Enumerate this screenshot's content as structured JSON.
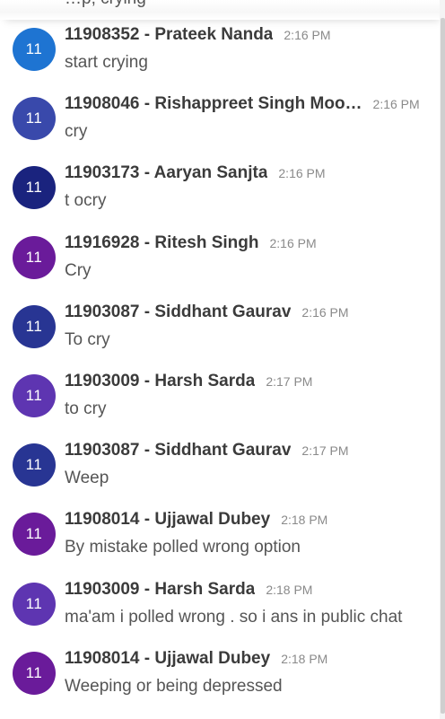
{
  "partial_top_text": "…p, crying",
  "messages": [
    {
      "avatar": "11",
      "color": "#1e74d2",
      "sender": "11908352 - Prateek Nanda",
      "time": "2:16 PM",
      "text": "start crying"
    },
    {
      "avatar": "11",
      "color": "#3949ab",
      "sender": "11908046 - Rishappreet Singh Moo…",
      "time": "2:16 PM",
      "text": "cry"
    },
    {
      "avatar": "11",
      "color": "#1a237e",
      "sender": "11903173 - Aaryan Sanjta",
      "time": "2:16 PM",
      "text": "t ocry"
    },
    {
      "avatar": "11",
      "color": "#6a1b9a",
      "sender": "11916928 - Ritesh Singh",
      "time": "2:16 PM",
      "text": "Cry"
    },
    {
      "avatar": "11",
      "color": "#283593",
      "sender": "11903087 - Siddhant Gaurav",
      "time": "2:16 PM",
      "text": "To cry"
    },
    {
      "avatar": "11",
      "color": "#5e35b1",
      "sender": "11903009 - Harsh Sarda",
      "time": "2:17 PM",
      "text": "to cry"
    },
    {
      "avatar": "11",
      "color": "#283593",
      "sender": "11903087 - Siddhant Gaurav",
      "time": "2:17 PM",
      "text": "Weep"
    },
    {
      "avatar": "11",
      "color": "#6a1b9a",
      "sender": "11908014 - Ujjawal Dubey",
      "time": "2:18 PM",
      "text": "By mistake polled wrong option"
    },
    {
      "avatar": "11",
      "color": "#5e35b1",
      "sender": "11903009 - Harsh Sarda",
      "time": "2:18 PM",
      "text": "ma'am i polled wrong . so i ans in public chat"
    },
    {
      "avatar": "11",
      "color": "#6a1b9a",
      "sender": "11908014 - Ujjawal Dubey",
      "time": "2:18 PM",
      "text": "Weeping or being depressed"
    }
  ]
}
